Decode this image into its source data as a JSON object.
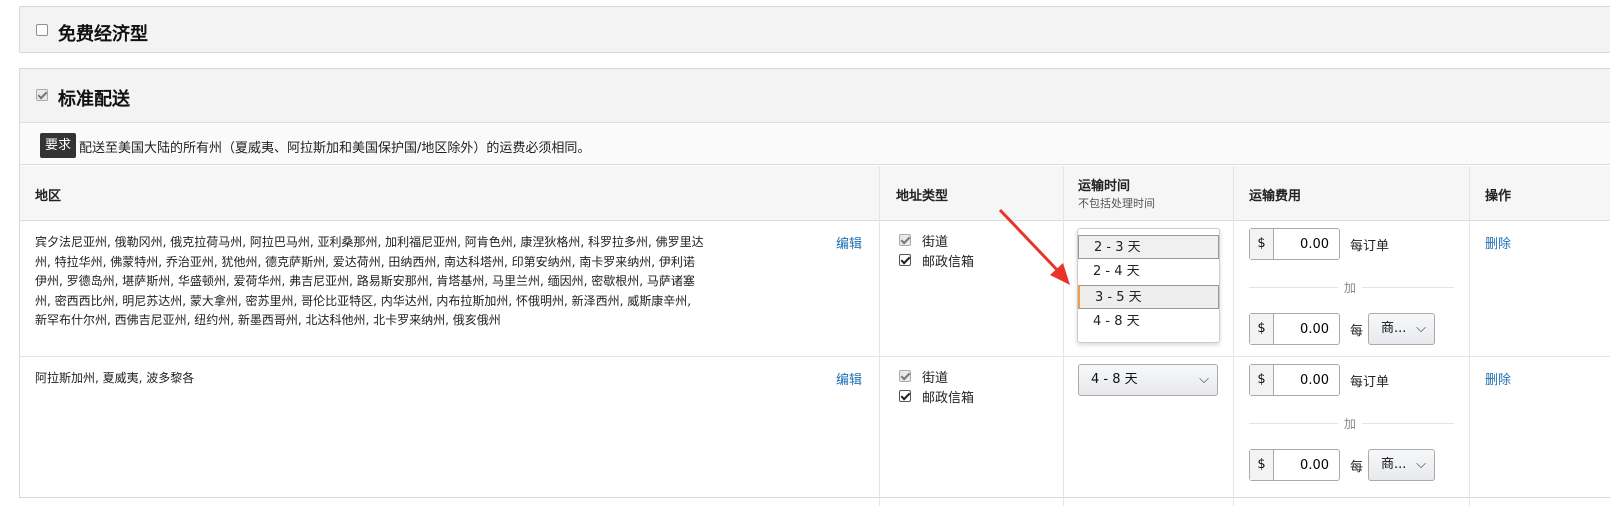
{
  "sections": {
    "free": {
      "title": "免费经济型",
      "checked": false
    },
    "standard": {
      "title": "标准配送",
      "checked": true
    }
  },
  "requirement": {
    "tag": "要求",
    "text": "配送至美国大陆的所有州（夏威夷、阿拉斯加和美国保护国/地区除外）的运费必须相同。"
  },
  "table": {
    "headers": {
      "region": "地区",
      "address_type": "地址类型",
      "transit_time": "运输时间",
      "transit_time_sub": "不包括处理时间",
      "shipping_fee": "运输费用",
      "actions": "操作"
    },
    "rows": [
      {
        "region": "宾夕法尼亚州, 俄勒冈州, 俄克拉荷马州, 阿拉巴马州, 亚利桑那州, 加利福尼亚州, 阿肯色州, 康涅狄格州, 科罗拉多州, 佛罗里达州, 特拉华州, 佛蒙特州, 乔治亚州, 犹他州, 德克萨斯州, 爱达荷州, 田纳西州, 南达科塔州, 印第安纳州, 南卡罗来纳州, 伊利诺伊州, 罗德岛州, 堪萨斯州, 华盛顿州, 爱荷华州, 弗吉尼亚州, 路易斯安那州, 肯塔基州, 马里兰州, 缅因州, 密歇根州, 马萨诸塞州, 密西西比州, 明尼苏达州, 蒙大拿州, 密苏里州, 哥伦比亚特区, 内华达州, 内布拉斯加州, 怀俄明州, 新泽西州, 威斯康辛州, 新罕布什尔州, 西佛吉尼亚州, 纽约州, 新墨西哥州, 北达科他州, 北卡罗来纳州, 俄亥俄州",
        "edit": "编辑",
        "address_types": [
          {
            "label": "街道",
            "checked": true,
            "disabled": true
          },
          {
            "label": "邮政信箱",
            "checked": true,
            "disabled": false
          }
        ],
        "transit_options": [
          "2 - 3 天",
          "2 - 4 天",
          "3 - 5 天",
          "4 - 8 天"
        ],
        "transit_highlighted": "3 - 5 天",
        "fee_currency": "$",
        "per_order_value": "0.00",
        "per_order_label": "每订单",
        "plus_label": "加",
        "per_unit_value": "0.00",
        "per_unit_label": "每",
        "per_unit_select": "商...",
        "delete": "删除"
      },
      {
        "region": "阿拉斯加州, 夏威夷, 波多黎各",
        "edit": "编辑",
        "address_types": [
          {
            "label": "街道",
            "checked": true,
            "disabled": true
          },
          {
            "label": "邮政信箱",
            "checked": true,
            "disabled": false
          }
        ],
        "transit_selected": "4 - 8 天",
        "fee_currency": "$",
        "per_order_value": "0.00",
        "per_order_label": "每订单",
        "plus_label": "加",
        "per_unit_value": "0.00",
        "per_unit_label": "每",
        "per_unit_select": "商...",
        "delete": "删除"
      }
    ]
  },
  "annotation": {
    "color": "#e8352b"
  }
}
